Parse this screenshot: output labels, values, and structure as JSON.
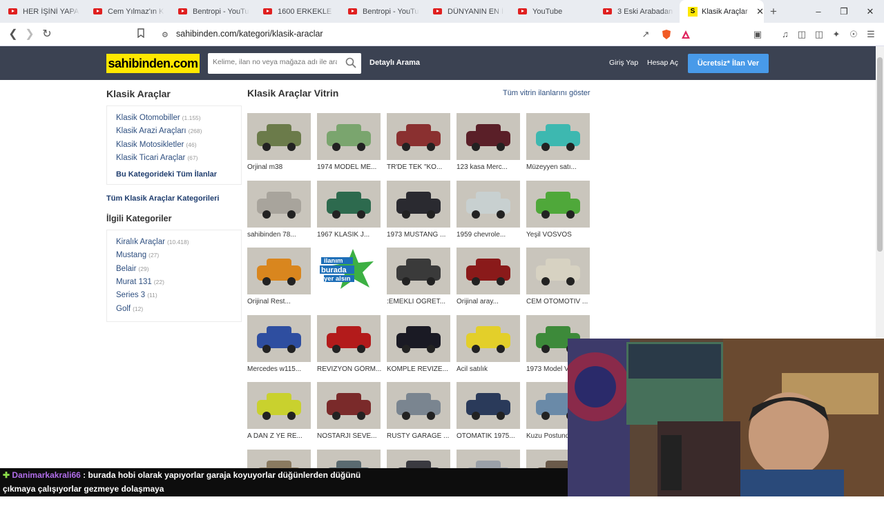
{
  "browser": {
    "tabs": [
      {
        "title": "HER İŞİNİ YAPAN 2",
        "icon": "youtube-icon"
      },
      {
        "title": "Cem Yılmaz'ın Kat",
        "icon": "youtube-icon"
      },
      {
        "title": "Bentropi - YouTub",
        "icon": "youtube-icon"
      },
      {
        "title": "1600 ERKEKLE BİR",
        "icon": "youtube-icon"
      },
      {
        "title": "Bentropi - YouTub",
        "icon": "youtube-icon"
      },
      {
        "title": "DÜNYANIN EN İYİ",
        "icon": "youtube-icon"
      },
      {
        "title": "YouTube",
        "icon": "youtube-icon"
      },
      {
        "title": "3 Eski Arabadan K",
        "icon": "youtube-icon"
      },
      {
        "title": "Klasik Araçlar",
        "icon": "sahibinden-icon",
        "active": true
      }
    ],
    "url": "sahibinden.com/kategori/klasik-araclar"
  },
  "site": {
    "logo": "sahibinden.com",
    "search_placeholder": "Kelime, ilan no veya mağaza adı ile ara",
    "detailed_search": "Detaylı Arama",
    "login": "Giriş Yap",
    "register": "Hesap Aç",
    "post_ad": "Ücretsiz* İlan Ver",
    "accent": "#ffe800",
    "header_bg": "#3b4252"
  },
  "sidebar": {
    "title": "Klasik Araçlar",
    "categories": [
      {
        "label": "Klasik Otomobiller",
        "count": "(1.155)"
      },
      {
        "label": "Klasik Arazi Araçları",
        "count": "(268)"
      },
      {
        "label": "Klasik Motosikletler",
        "count": "(46)"
      },
      {
        "label": "Klasik Ticari Araçlar",
        "count": "(67)"
      }
    ],
    "all_in_category": "Bu Kategorideki Tüm İlanlar",
    "all_classic_categories": "Tüm Klasik Araçlar Kategorileri",
    "related_title": "İlgili Kategoriler",
    "related": [
      {
        "label": "Kiralık Araçlar",
        "count": "(10.418)"
      },
      {
        "label": "Mustang",
        "count": "(27)"
      },
      {
        "label": "Belair",
        "count": "(29)"
      },
      {
        "label": "Murat 131",
        "count": "(22)"
      },
      {
        "label": "Series 3",
        "count": "(11)"
      },
      {
        "label": "Golf",
        "count": "(12)"
      }
    ]
  },
  "vitrin": {
    "title": "Klasik Araçlar Vitrin",
    "show_all": "Tüm vitrin ilanlarını göster",
    "items": [
      {
        "caption": "Orjinal m38",
        "color": "#6b7b4a"
      },
      {
        "caption": "1974 MODEL ME...",
        "color": "#7aa56e"
      },
      {
        "caption": "TR'DE TEK \"KO...",
        "color": "#8a3030"
      },
      {
        "caption": "123 kasa Merc...",
        "color": "#5a1f28"
      },
      {
        "caption": "Müzeyyen satı...",
        "color": "#3db8b0"
      },
      {
        "caption": "sahibinden 78...",
        "color": "#a8a49c"
      },
      {
        "caption": "1967 KLASİK J...",
        "color": "#2d6a4e"
      },
      {
        "caption": "1973 MUSTANG ...",
        "color": "#2a2a30"
      },
      {
        "caption": "1959 chevrole...",
        "color": "#c8d0d0"
      },
      {
        "caption": "Yeşil VOSVOS",
        "color": "#4fa83a"
      },
      {
        "caption": "Orijinal Rest...",
        "color": "#d9861e"
      },
      {
        "caption": "",
        "color": "#ffffff",
        "badge": [
          "ilanım",
          "burada",
          "yer alsın"
        ]
      },
      {
        "caption": ":EMEKLİ ÖĞRET...",
        "color": "#3a3a3a"
      },
      {
        "caption": "Orijinal aray...",
        "color": "#8a1a1a"
      },
      {
        "caption": "CEM OTOMOTİV ...",
        "color": "#d7d2c2"
      },
      {
        "caption": "Mercedes w115...",
        "color": "#2e4ea0"
      },
      {
        "caption": "REVİZYON GÖRM...",
        "color": "#b31b1b"
      },
      {
        "caption": "KOMPLE REVİZE...",
        "color": "#1a1a24"
      },
      {
        "caption": "Acil satılık",
        "color": "#e3cf2a"
      },
      {
        "caption": "1973 Model V",
        "color": "#3d8a3a"
      },
      {
        "caption": "A DAN Z YE RE...",
        "color": "#c9d12e"
      },
      {
        "caption": "NOSTARJİ SEVE...",
        "color": "#7a2a2a"
      },
      {
        "caption": "RUSTY GARAGE ...",
        "color": "#7a8590"
      },
      {
        "caption": "OTOMATİK 1975...",
        "color": "#2a3a5a"
      },
      {
        "caption": "Kuzu Postund",
        "color": "#6a8aa8"
      },
      {
        "caption": "",
        "color": "#8a7a60"
      },
      {
        "caption": "",
        "color": "#5a6a70"
      },
      {
        "caption": "",
        "color": "#3a3a40"
      },
      {
        "caption": "",
        "color": "#9aa0a8"
      },
      {
        "caption": "",
        "color": "#6a5a4a"
      }
    ]
  },
  "chat": {
    "username": "Danimarkakrali66",
    "line1": ": burada hobi olarak yapıyorlar garaja koyuyorlar düğünlerden düğünü",
    "line2": "çıkmaya çalışıyorlar gezmeye dolaşmaya"
  }
}
